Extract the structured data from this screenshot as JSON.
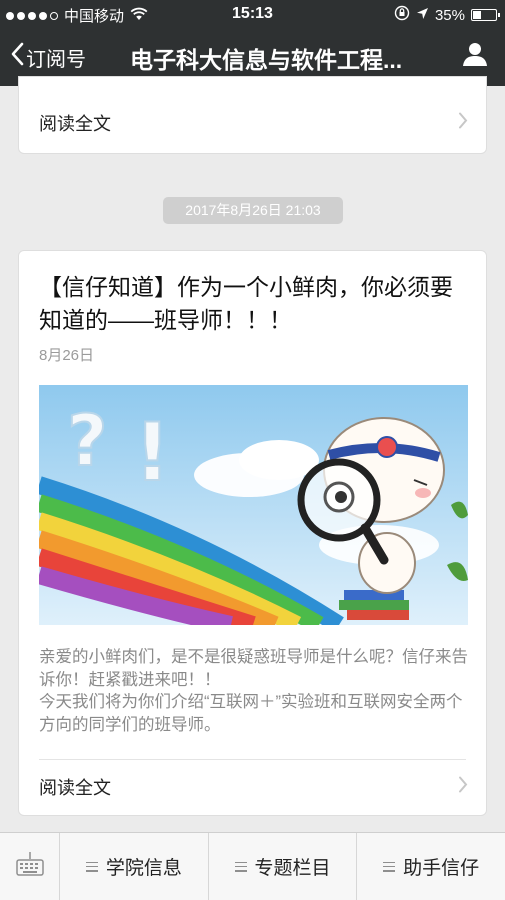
{
  "status_bar": {
    "carrier": "中国移动",
    "time": "15:13",
    "battery_percent": "35%",
    "battery_level": 0.35,
    "signal_bars_filled": 4,
    "signal_bars_total": 5,
    "icons": [
      "signal-dots-icon",
      "wifi-icon",
      "rotation-lock-icon",
      "location-arrow-icon",
      "battery-icon"
    ]
  },
  "nav": {
    "back_label": "订阅号",
    "title": "电子科大信息与软件工程...",
    "icons": [
      "chevron-left-icon",
      "user-icon"
    ]
  },
  "previous_article": {
    "read_more_label": "阅读全文"
  },
  "timestamp": "2017年8月26日 21:03",
  "article": {
    "title": "【信仔知道】作为一个小鲜肉，你必须要知道的——班导师！！！",
    "date": "8月26日",
    "summary": "亲爱的小鲜肉们，是不是很疑惑班导师是什么呢？信仔来告诉你！赶紧戳进来吧！！\n今天我们将为你们介绍“互联网＋”实验班和互联网安全两个方向的同学们的班导师。",
    "read_more_label": "阅读全文"
  },
  "bottom_menu": {
    "items": [
      {
        "label": "学院信息"
      },
      {
        "label": "专题栏目"
      },
      {
        "label": "助手信仔"
      }
    ],
    "icons": [
      "keyboard-icon",
      "menu-lines-icon"
    ]
  },
  "colors": {
    "nav_background": "#2e3132",
    "page_background": "#ebebeb",
    "card_background": "#ffffff",
    "timestamp_pill": "#cfcfcf"
  }
}
